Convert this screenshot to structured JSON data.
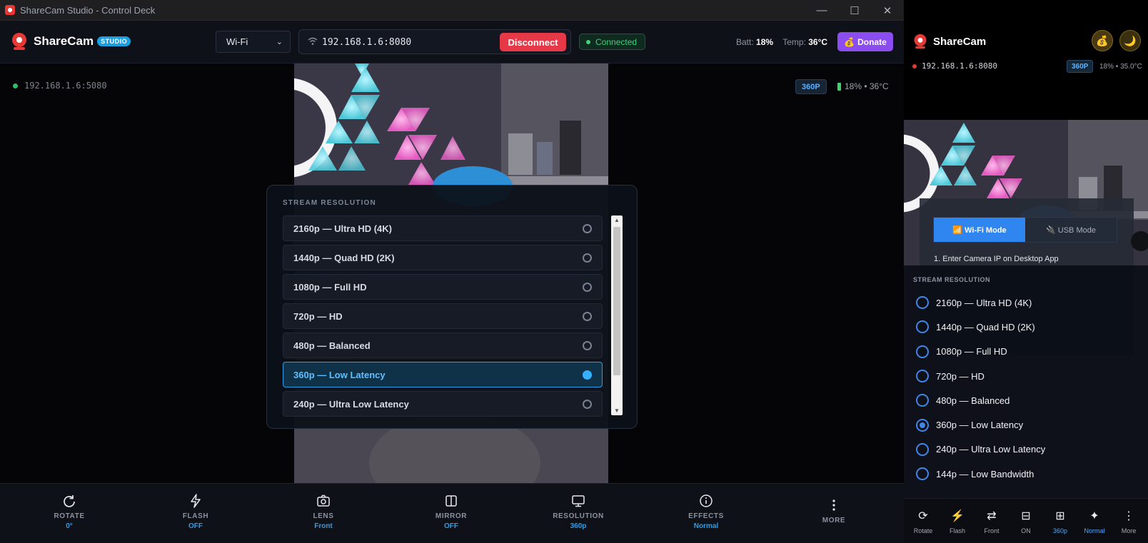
{
  "window": {
    "title": "ShareCam Studio - Control Deck"
  },
  "header": {
    "brand": "ShareCam",
    "badge": "STUDIO",
    "mode_select": "Wi-Fi",
    "ip_address": "192.168.1.6:8080",
    "disconnect_label": "Disconnect",
    "status_label": "Connected",
    "batt_label": "Batt:",
    "batt_value": "18%",
    "temp_label": "Temp:",
    "temp_value": "36°C",
    "donate_label": "Donate"
  },
  "stage": {
    "ip_readout": "192.168.1.6:5080",
    "resolution_badge": "360P",
    "battery_temp": "18% • 36°C"
  },
  "resolution_modal": {
    "title": "STREAM RESOLUTION",
    "options": [
      {
        "label": "2160p — Ultra HD (4K)",
        "selected": false
      },
      {
        "label": "1440p — Quad HD (2K)",
        "selected": false
      },
      {
        "label": "1080p — Full HD",
        "selected": false
      },
      {
        "label": "720p — HD",
        "selected": false
      },
      {
        "label": "480p — Balanced",
        "selected": false
      },
      {
        "label": "360p — Low Latency",
        "selected": true
      },
      {
        "label": "240p — Ultra Low Latency",
        "selected": false
      }
    ]
  },
  "toolbar": {
    "items": [
      {
        "label": "ROTATE",
        "value": "0°",
        "icon": "rotate-icon"
      },
      {
        "label": "FLASH",
        "value": "OFF",
        "icon": "flash-icon"
      },
      {
        "label": "LENS",
        "value": "Front",
        "icon": "camera-icon"
      },
      {
        "label": "MIRROR",
        "value": "OFF",
        "icon": "mirror-icon"
      },
      {
        "label": "RESOLUTION",
        "value": "360p",
        "icon": "monitor-icon"
      },
      {
        "label": "EFFECTS",
        "value": "Normal",
        "icon": "info-icon"
      },
      {
        "label": "MORE",
        "value": "",
        "icon": "more-icon"
      }
    ]
  },
  "mobile": {
    "brand": "ShareCam",
    "ip_address": "192.168.1.6:8080",
    "resolution_badge": "360P",
    "battery_temp": "18% • 35.0°C",
    "tab_wifi": "📶 Wi-Fi Mode",
    "tab_usb": "🔌 USB Mode",
    "step_1": "1. Enter Camera IP on Desktop App",
    "sheet_title": "STREAM RESOLUTION",
    "options": [
      {
        "label": "2160p — Ultra HD (4K)",
        "selected": false
      },
      {
        "label": "1440p — Quad HD (2K)",
        "selected": false
      },
      {
        "label": "1080p — Full HD",
        "selected": false
      },
      {
        "label": "720p — HD",
        "selected": false
      },
      {
        "label": "480p — Balanced",
        "selected": false
      },
      {
        "label": "360p — Low Latency",
        "selected": true
      },
      {
        "label": "240p — Ultra Low Latency",
        "selected": false
      },
      {
        "label": "144p — Low Bandwidth",
        "selected": false
      }
    ],
    "bottom_bar": [
      {
        "label": "Rotate",
        "icon": "rotate-icon"
      },
      {
        "label": "Flash",
        "icon": "flash-icon"
      },
      {
        "label": "Front",
        "icon": "swap-icon"
      },
      {
        "label": "ON",
        "icon": "mirror-icon"
      },
      {
        "label": "360p",
        "icon": "grid-icon"
      },
      {
        "label": "Normal",
        "icon": "sparkle-icon"
      },
      {
        "label": "More",
        "icon": "more-icon"
      }
    ]
  },
  "colors": {
    "accent": "#2f9eea",
    "danger": "#e53947",
    "donate": "#8b4cf0",
    "success": "#44d07c"
  }
}
